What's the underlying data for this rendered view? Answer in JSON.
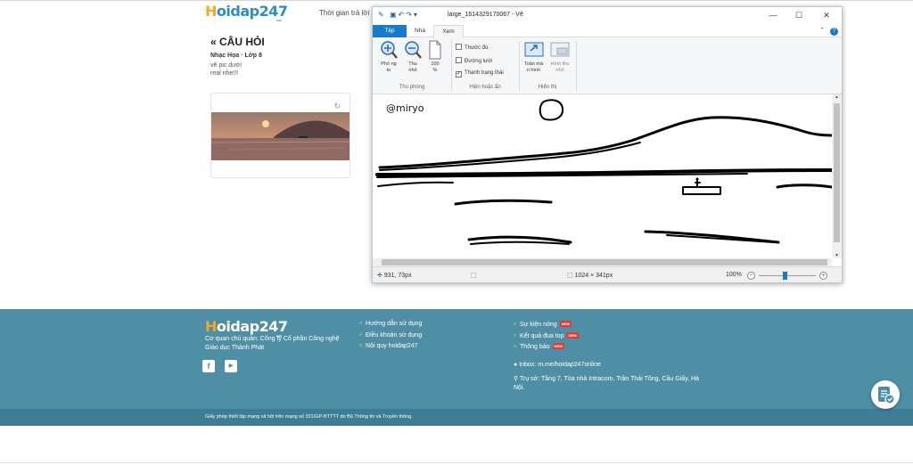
{
  "page": {
    "logo_h": "H",
    "logo_rest": "oidap247",
    "logo_com": ".com",
    "time_hint": "Thời gian trả lời cò",
    "question_title": "« CÂU HỎI",
    "question_subject": "Nhạc Họa · Lớp 8",
    "question_text": "vẽ pic dưới\nreal nhe!!!"
  },
  "paint": {
    "title": "large_1614329170067 - Vẽ",
    "tabs": [
      {
        "label": "Tệp"
      },
      {
        "label": "Nhà"
      },
      {
        "label": "Xem"
      }
    ],
    "zoom_group": {
      "zoom_in": "Phó ng to",
      "zoom_out": "Thu nhỏ",
      "hundred": "100 %",
      "label": "Thu phóng"
    },
    "show_group": {
      "rulers": "Thước đo",
      "gridlines": "Đường lưới",
      "statusbar": "Thanh trạng thái",
      "statusbar_check": "✓",
      "label": "Hiện hoặc ẩn"
    },
    "display_group": {
      "fullscreen": "Toàn mà n hình",
      "thumbnail": "Hình thu nhỏ",
      "label": "Hiển thị"
    },
    "canvas_text": "@miryo",
    "status": {
      "position": "931, 73px",
      "size": "1024 × 341px",
      "zoom": "100%"
    }
  },
  "footer": {
    "logo_h": "H",
    "logo_rest": "oidap247",
    "logo_com": ".com",
    "owner_line1": "Cơ quan chủ quản: Công ty Cổ phần Công nghệ",
    "owner_line2": "Giáo dục Thành Phát",
    "links_col1": [
      "Hướng dẫn sử dụng",
      "Điều khoản sử dụng",
      "Nội quy hoidap247"
    ],
    "links_col2": [
      "Sự kiện nóng",
      "Kết quả đua top",
      "Thông báo"
    ],
    "badge": "NEW",
    "inbox": "Inbox: m.me/hoidap247online",
    "address_line1": "Trụ sở: Tầng 7, Tòa nhà Intracom, Trần Thái Tông, Cầu Giấy, Hà",
    "address_line2": "Nội.",
    "license": "Giấy phép thiết lập mạng xã hội trên mạng số 331/GP-BTTTT do Bộ Thông tin và Truyền thông."
  }
}
